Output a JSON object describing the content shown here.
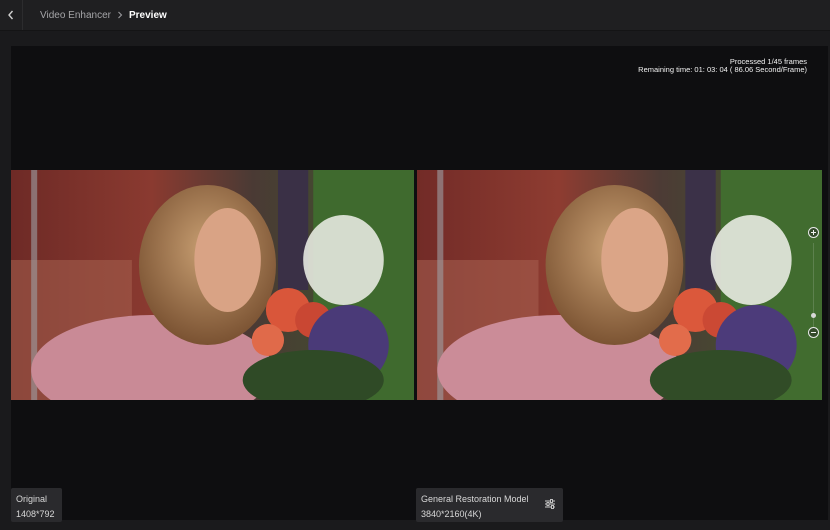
{
  "header": {
    "back_icon": "chevron-left-icon",
    "breadcrumb": {
      "parent": "Video Enhancer",
      "separator_icon": "chevron-right-icon",
      "current": "Preview"
    }
  },
  "progress": {
    "processed": "Processed 1/45 frames",
    "remaining": "Remaining time: 01: 03: 04 ( 86.06 Second/Frame)"
  },
  "original": {
    "label": "Original",
    "resolution": "1408*792"
  },
  "enhanced": {
    "label": "General Restoration Model",
    "resolution": "3840*2160(4K)",
    "settings_icon": "sliders-icon"
  },
  "zoom": {
    "in_icon": "plus-icon",
    "out_icon": "minus-icon",
    "level": 0.15
  },
  "colors": {
    "background": "#1a1a1c",
    "stage": "#0e0e10",
    "label_bg": "#2a2a2d",
    "text": "#d6d6d6"
  }
}
